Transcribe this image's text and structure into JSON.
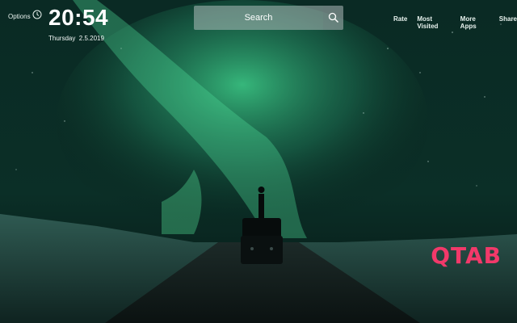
{
  "header": {
    "options_label": "Options",
    "time": "20:54",
    "date": "Thursday  2.5.2019"
  },
  "search": {
    "placeholder": "Search",
    "icon": "search-icon"
  },
  "nav": {
    "items": [
      {
        "label": "Rate"
      },
      {
        "label": "Most Visited"
      },
      {
        "label": "More Apps"
      },
      {
        "label": "Share"
      }
    ]
  },
  "brand": {
    "logo_text": "QTAB",
    "color": "#f2396a"
  },
  "icons": {
    "clock": "clock-icon"
  },
  "colors": {
    "sky": "#04110f",
    "aurora": "#3ecf8a",
    "text": "#ffffff"
  }
}
